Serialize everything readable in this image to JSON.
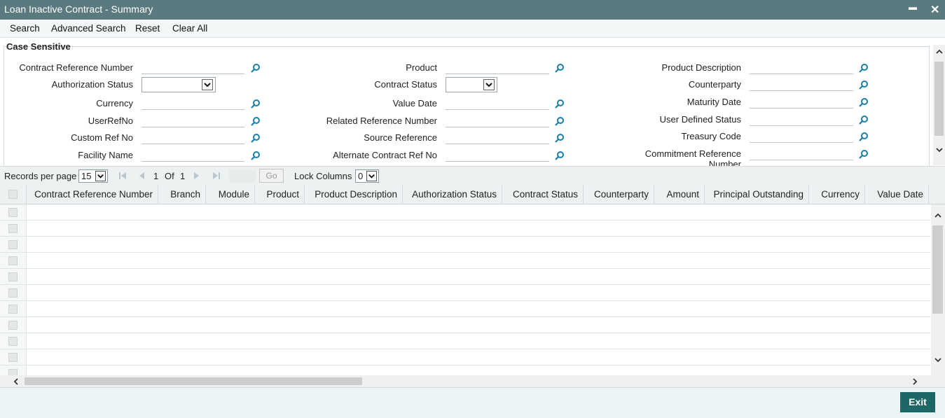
{
  "window": {
    "title": "Loan Inactive Contract - Summary",
    "minimize_glyph": "▬",
    "close_glyph": "✕"
  },
  "toolbar": {
    "search": "Search",
    "advanced_search": "Advanced Search",
    "reset": "Reset",
    "clear_all": "Clear All"
  },
  "criteria": {
    "legend": "Case Sensitive",
    "col1": {
      "contract_ref": "Contract Reference Number",
      "auth_status": "Authorization Status",
      "currency": "Currency",
      "userrefno": "UserRefNo",
      "custom_ref": "Custom Ref No",
      "facility_name": "Facility Name"
    },
    "col2": {
      "product": "Product",
      "contract_status": "Contract Status",
      "value_date": "Value Date",
      "related_ref": "Related Reference Number",
      "source_ref": "Source Reference",
      "alt_contract_ref": "Alternate Contract Ref No"
    },
    "col3": {
      "product_desc": "Product Description",
      "counterparty": "Counterparty",
      "maturity_date": "Maturity Date",
      "user_defined_status": "User Defined Status",
      "treasury_code": "Treasury Code",
      "commitment_ref": "Commitment Reference Number"
    }
  },
  "pager": {
    "records_per_page_label": "Records per page",
    "records_per_page_value": "15",
    "current_page": "1",
    "of_label": "Of",
    "total_pages": "1",
    "go_label": "Go",
    "lock_columns_label": "Lock Columns",
    "lock_columns_value": "0"
  },
  "grid": {
    "columns": [
      "Contract Reference Number",
      "Branch",
      "Module",
      "Product",
      "Product Description",
      "Authorization Status",
      "Contract Status",
      "Counterparty",
      "Amount",
      "Principal Outstanding",
      "Currency",
      "Value Date"
    ],
    "rows": []
  },
  "footer": {
    "exit_label": "Exit"
  },
  "colors": {
    "titlebar": "#5a7a7f",
    "lens_icon": "#1a7fa8",
    "exit_button": "#1d6766"
  },
  "icons": {
    "lens": "search-icon",
    "first": "first-page-icon",
    "prev": "prev-page-icon",
    "next": "next-page-icon",
    "last": "last-page-icon"
  }
}
